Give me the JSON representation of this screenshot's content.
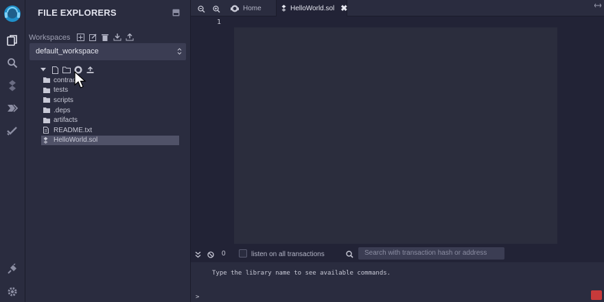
{
  "panel": {
    "title": "FILE EXPLORERS",
    "workspaces_label": "Workspaces",
    "workspace_selected": "default_workspace"
  },
  "tree": {
    "items": [
      {
        "label": "contracts",
        "icon": "folder-icon"
      },
      {
        "label": "tests",
        "icon": "folder-icon"
      },
      {
        "label": "scripts",
        "icon": "folder-icon"
      },
      {
        "label": ".deps",
        "icon": "folder-icon"
      },
      {
        "label": "artifacts",
        "icon": "folder-icon"
      },
      {
        "label": "README.txt",
        "icon": "file-icon"
      },
      {
        "label": "HelloWorld.sol",
        "icon": "solidity-file-icon"
      }
    ]
  },
  "tabs": {
    "home": "Home",
    "active": "HelloWorld.sol",
    "close": "✖"
  },
  "editor": {
    "line_numbers": [
      "1"
    ]
  },
  "terminal": {
    "count": "0",
    "listen_label": "listen on all transactions",
    "search_placeholder": "Search with transaction hash or address",
    "message": "Type the library name to see available commands.",
    "prompt": ">"
  },
  "colors": {
    "background": "#222336",
    "panel": "#2a2c3f",
    "editor": "#2b2d3d",
    "accent": "#1f8fc9"
  }
}
